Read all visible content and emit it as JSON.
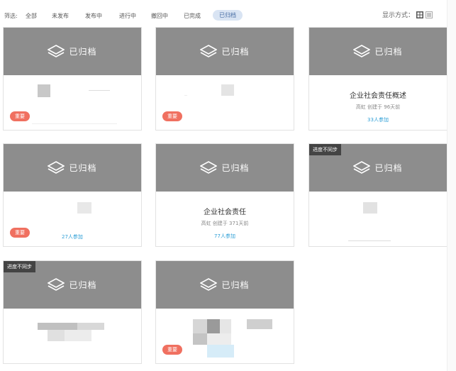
{
  "filter": {
    "label": "筛选:",
    "items": [
      "全部",
      "未发布",
      "发布中",
      "进行中",
      "撤回中",
      "已完成",
      "已归档"
    ],
    "active_index": 6
  },
  "display": {
    "label": "显示方式："
  },
  "card_head_label": "已归档",
  "progress_tag": "进度不同步",
  "important_label": "重要",
  "cards": [
    {
      "important": true
    },
    {
      "important": true
    },
    {
      "title": "企业社会责任概述",
      "author": "高虹",
      "time": "创建于 96天前",
      "participants": "33人参加"
    },
    {
      "important": true,
      "participants": "27人参加"
    },
    {
      "title": "企业社会责任",
      "author": "高虹",
      "time": "创建于 371天前",
      "participants": "77人参加"
    },
    {
      "progress_tag": true
    },
    {
      "progress_tag": true
    },
    {
      "important": true
    }
  ],
  "colors": {
    "card_head": "#8d8d8d",
    "important": "#f07060",
    "participants": "#2e9fd6",
    "filter_active_bg": "#d9e4f3"
  }
}
